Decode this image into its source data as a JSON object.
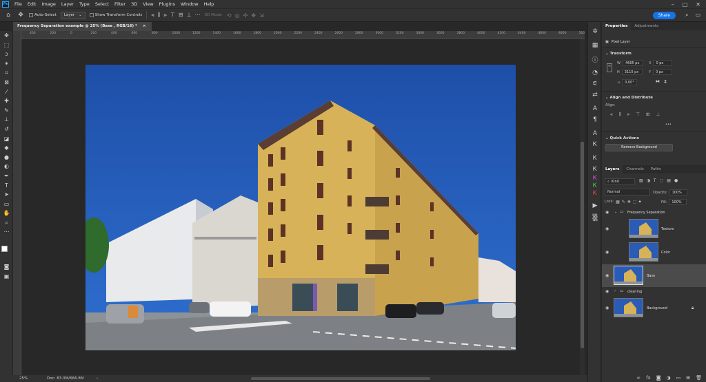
{
  "menubar": {
    "app_icon": "Ps",
    "items": [
      "File",
      "Edit",
      "Image",
      "Layer",
      "Type",
      "Select",
      "Filter",
      "3D",
      "View",
      "Plugins",
      "Window",
      "Help"
    ]
  },
  "options": {
    "auto_select": "Auto-Select",
    "layer_dd": "Layer",
    "transform": "Show Transform Controls",
    "mode_3d": "3D Mode:",
    "share": "Share"
  },
  "document": {
    "tab_title": "Frequency Separation example @ 25% (Base , RGB/16) *",
    "close": "×",
    "ruler_ticks": [
      "400",
      "200",
      "0",
      "200",
      "400",
      "600",
      "800",
      "1000",
      "1200",
      "1400",
      "1600",
      "1800",
      "2000",
      "2200",
      "2400",
      "2600",
      "2800",
      "3000",
      "3200",
      "3400",
      "3600",
      "3800",
      "4000",
      "4200",
      "4400",
      "4600",
      "4800",
      "5000"
    ]
  },
  "status": {
    "zoom": "25%",
    "doc": "Doc: 83.0M/666.8M",
    "arrow": "›"
  },
  "properties": {
    "tabs": [
      "Properties",
      "Adjustments"
    ],
    "layer_type": "Pixel Layer",
    "transform_hdr": "Transform",
    "w_label": "W",
    "w_value": "4665 px",
    "h_label": "H",
    "h_value": "3110 px",
    "x_label": "X",
    "x_value": "0 px",
    "y_label": "Y",
    "y_value": "0 px",
    "angle": "0,00°",
    "align_hdr": "Align and Distribute",
    "align_label": "Align:",
    "more": "•••",
    "quick_hdr": "Quick Actions",
    "remove_bg": "Remove Background"
  },
  "layers": {
    "tabs": [
      "Layers",
      "Channels",
      "Paths"
    ],
    "kind": "Kind",
    "blend": "Normal",
    "opacity_label": "Opacity:",
    "opacity": "100%",
    "lock_label": "Lock:",
    "fill_label": "Fill:",
    "fill": "100%",
    "items": [
      {
        "name": "Frequency Separation",
        "type": "group"
      },
      {
        "name": "Texture",
        "type": "layer"
      },
      {
        "name": "Color",
        "type": "layer"
      },
      {
        "name": "Base",
        "type": "layer"
      },
      {
        "name": "cleaning",
        "type": "group"
      },
      {
        "name": "Background",
        "type": "layer"
      }
    ]
  },
  "colors": {
    "accent": "#1473e6",
    "sky": "#1f4fa6",
    "building": "#d7b258"
  }
}
